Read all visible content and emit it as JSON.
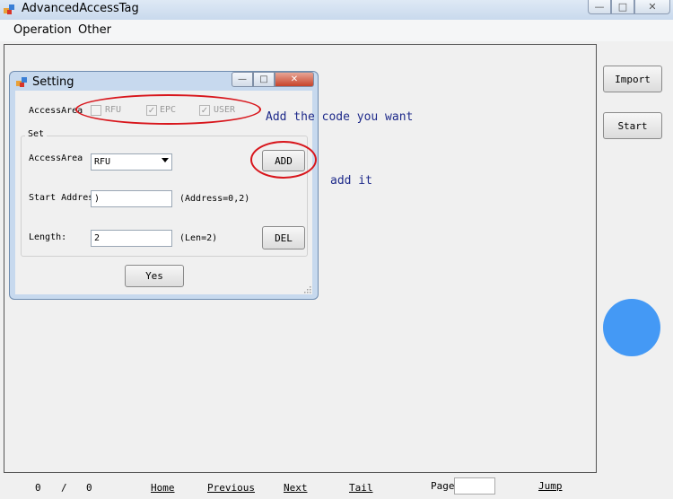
{
  "app": {
    "title": "AdvancedAccessTag",
    "icon": "app-icon"
  },
  "window_controls": {
    "min_icon": "minimize-icon",
    "max_icon": "maximize-icon",
    "close_icon": "close-icon"
  },
  "menu": [
    {
      "label": "Operation"
    },
    {
      "label": "Other"
    }
  ],
  "side_buttons": {
    "import_label": "Import",
    "start_label": "Start"
  },
  "status_indicator": {
    "color": "#4499f5"
  },
  "pager": {
    "current": "0",
    "separator": "/",
    "total": "0",
    "home": "Home",
    "previous": "Previous",
    "next": "Next",
    "tail": "Tail",
    "page_label": "Page",
    "page_value": "",
    "jump": "Jump"
  },
  "dialog": {
    "title": "Setting",
    "access_area_label": "AccessArea",
    "checkboxes": [
      {
        "label": "RFU",
        "checked": false
      },
      {
        "label": "EPC",
        "checked": true
      },
      {
        "label": "USER",
        "checked": true
      }
    ],
    "set_group_label": "Set",
    "set_access_area_label": "AccessArea",
    "access_area_value": "RFU",
    "start_address_label": "Start Address",
    "start_address_value": ")",
    "start_address_hint": "(Address=0,2)",
    "length_label": "Length:",
    "length_value": "2",
    "length_hint": "(Len=2)",
    "add_label": "ADD",
    "del_label": "DEL",
    "yes_label": "Yes"
  },
  "annotations": {
    "add_code": "Add the code you want",
    "add_it": "add it",
    "highlight_color": "#d8161c",
    "text_color": "#1e2a8a"
  }
}
